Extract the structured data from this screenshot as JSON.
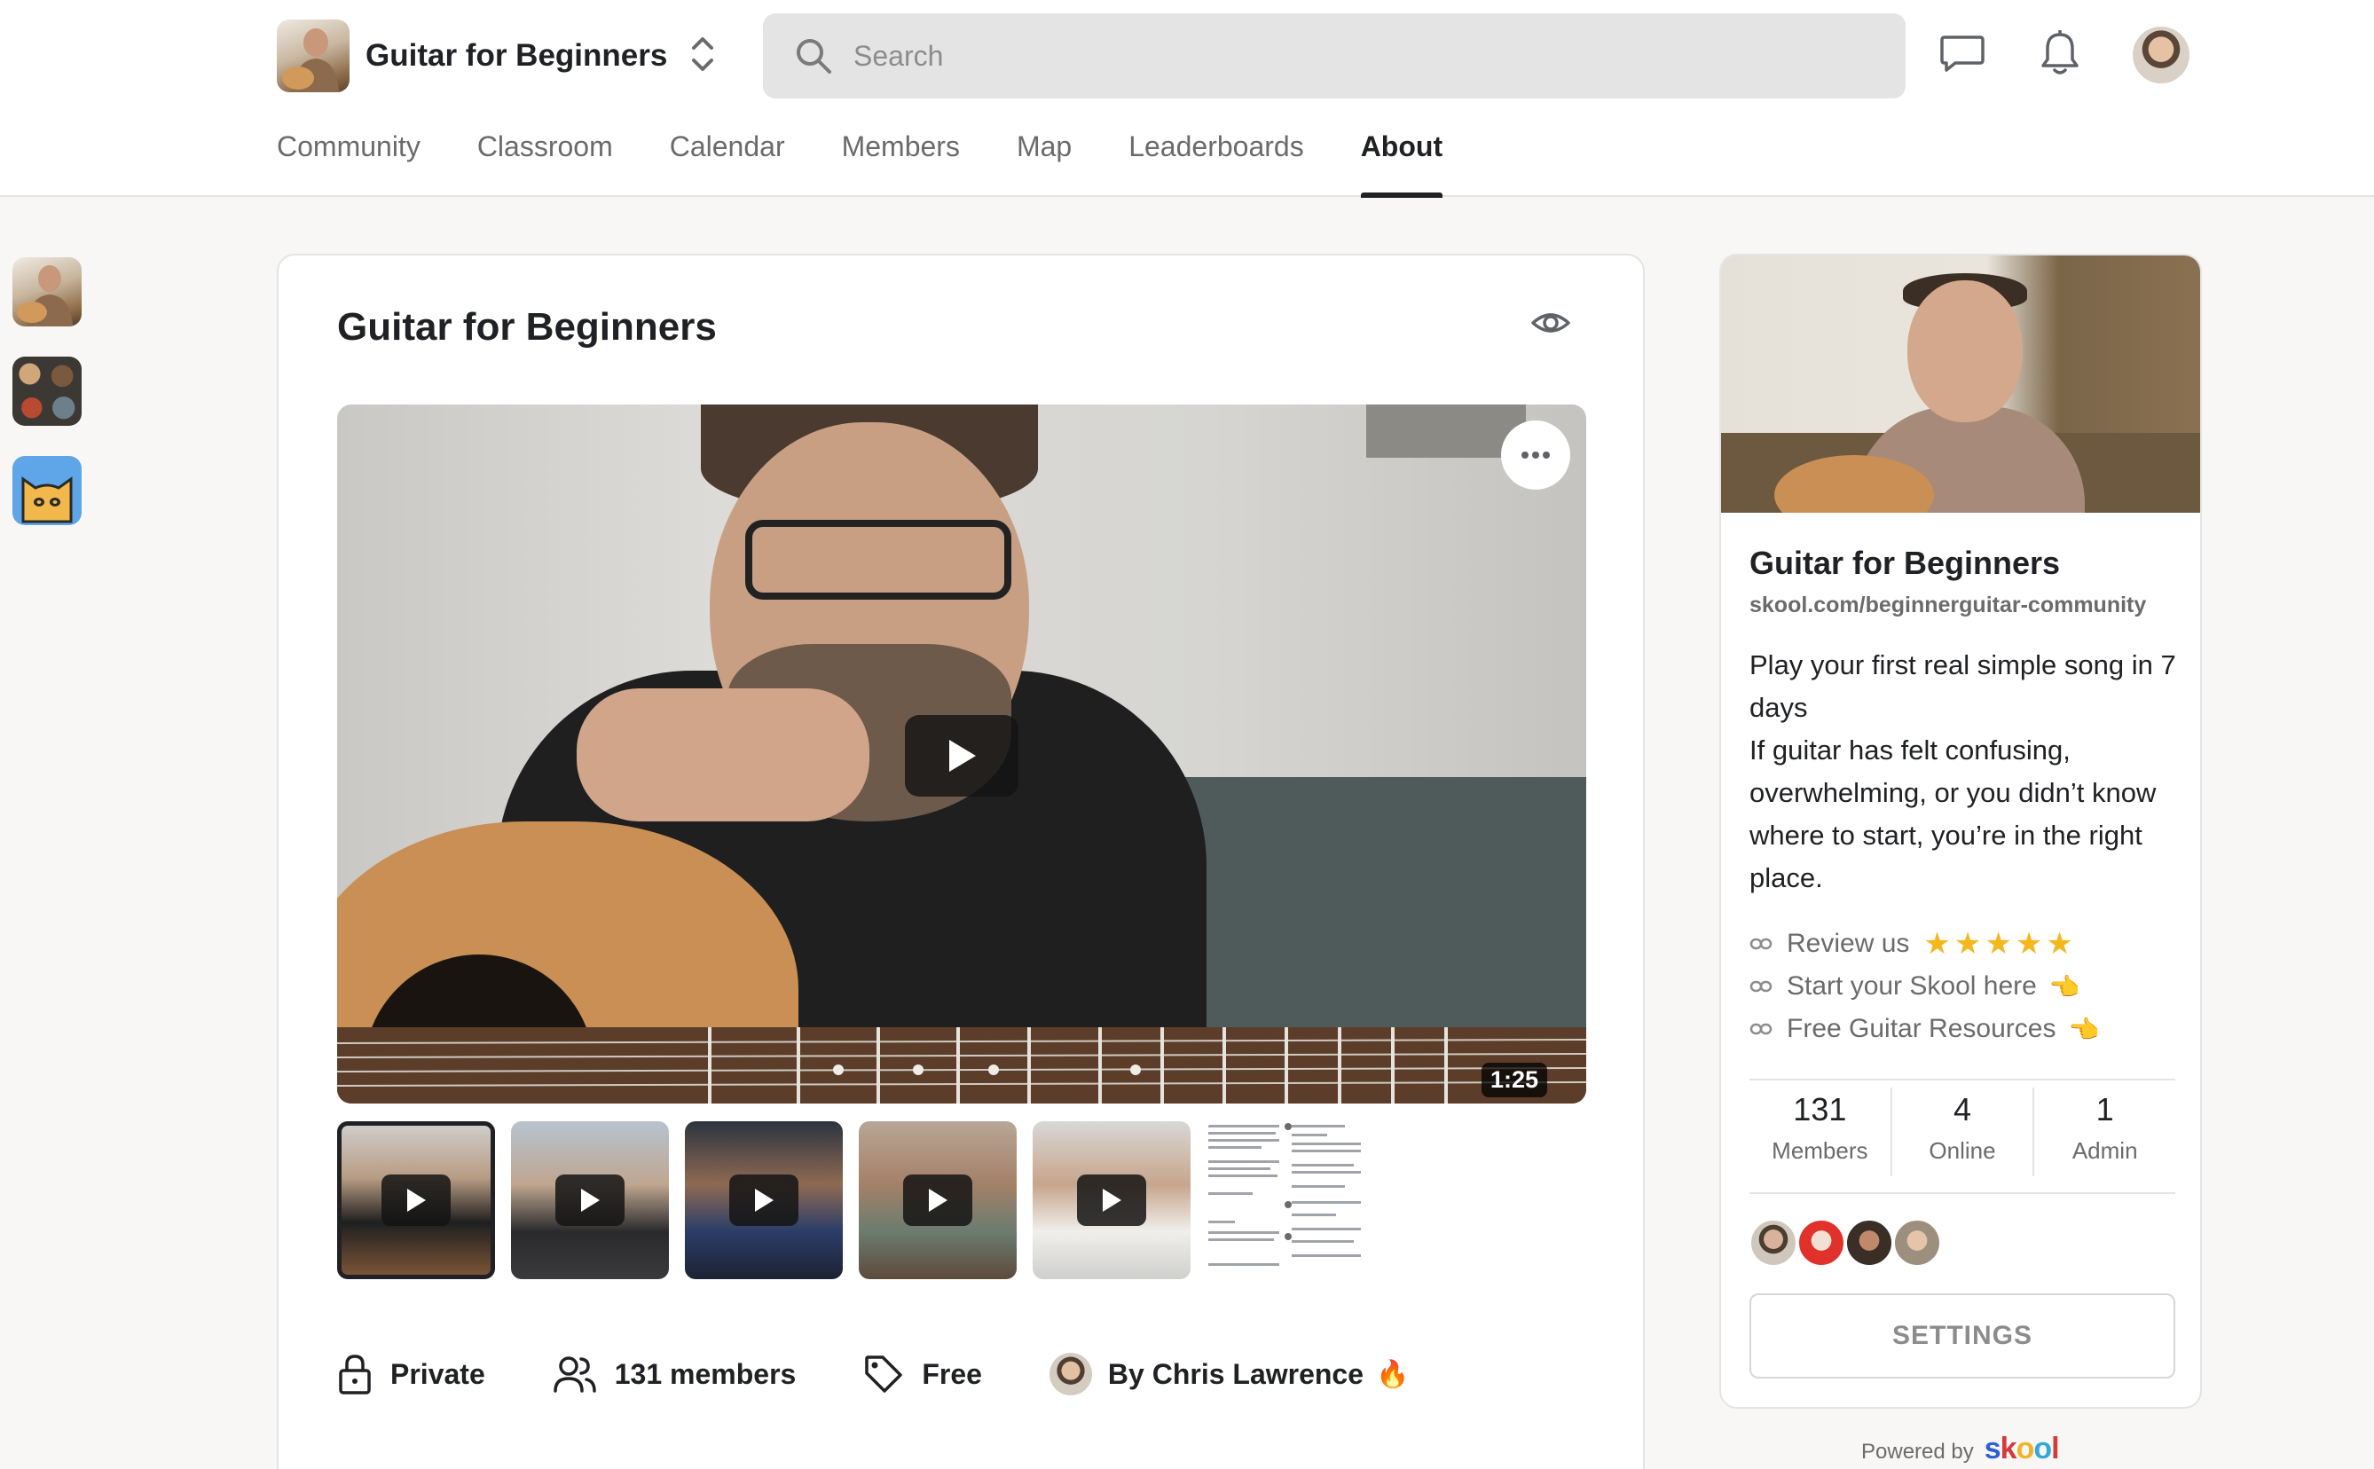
{
  "header": {
    "group_name": "Guitar for Beginners",
    "search_placeholder": "Search",
    "tabs": [
      {
        "label": "Community",
        "active": false
      },
      {
        "label": "Classroom",
        "active": false
      },
      {
        "label": "Calendar",
        "active": false
      },
      {
        "label": "Members",
        "active": false
      },
      {
        "label": "Map",
        "active": false
      },
      {
        "label": "Leaderboards",
        "active": false
      },
      {
        "label": "About",
        "active": true
      }
    ],
    "icons": [
      "chat-icon",
      "bell-icon"
    ]
  },
  "left_rail": {
    "groups": [
      "guitar-group-icon",
      "food-group-icon",
      "cat-group-icon"
    ]
  },
  "main": {
    "title": "Guitar for Beginners",
    "video": {
      "duration": "1:25"
    },
    "thumbnails": [
      {
        "kind": "video",
        "selected": true
      },
      {
        "kind": "video",
        "selected": false
      },
      {
        "kind": "video",
        "selected": false
      },
      {
        "kind": "video",
        "selected": false
      },
      {
        "kind": "video",
        "selected": false
      },
      {
        "kind": "image",
        "selected": false
      }
    ],
    "meta": {
      "privacy": "Private",
      "members": "131 members",
      "price": "Free",
      "owner": "By Chris Lawrence",
      "owner_badge": "🔥"
    }
  },
  "sidebar": {
    "name": "Guitar for Beginners",
    "url": "skool.com/beginnerguitar-community",
    "description": [
      "Play your first real simple song in 7 days",
      "If guitar has felt confusing, overwhelming, or you didn’t know where to start, you’re in the right place."
    ],
    "links": [
      {
        "label": "Review us",
        "suffix": "★★★★★"
      },
      {
        "label": "Start your Skool here",
        "suffix": "👈"
      },
      {
        "label": "Free Guitar Resources",
        "suffix": "👈"
      }
    ],
    "stats": [
      {
        "value": "131",
        "label": "Members"
      },
      {
        "value": "4",
        "label": "Online"
      },
      {
        "value": "1",
        "label": "Admin"
      }
    ],
    "settings_label": "SETTINGS"
  },
  "footer": {
    "powered_by": "Powered by",
    "brand": "skool"
  },
  "colors": {
    "accent_star": "#f4b81f",
    "text_primary": "#202124",
    "text_muted": "#6b6b6b",
    "background": "#f8f7f5"
  }
}
